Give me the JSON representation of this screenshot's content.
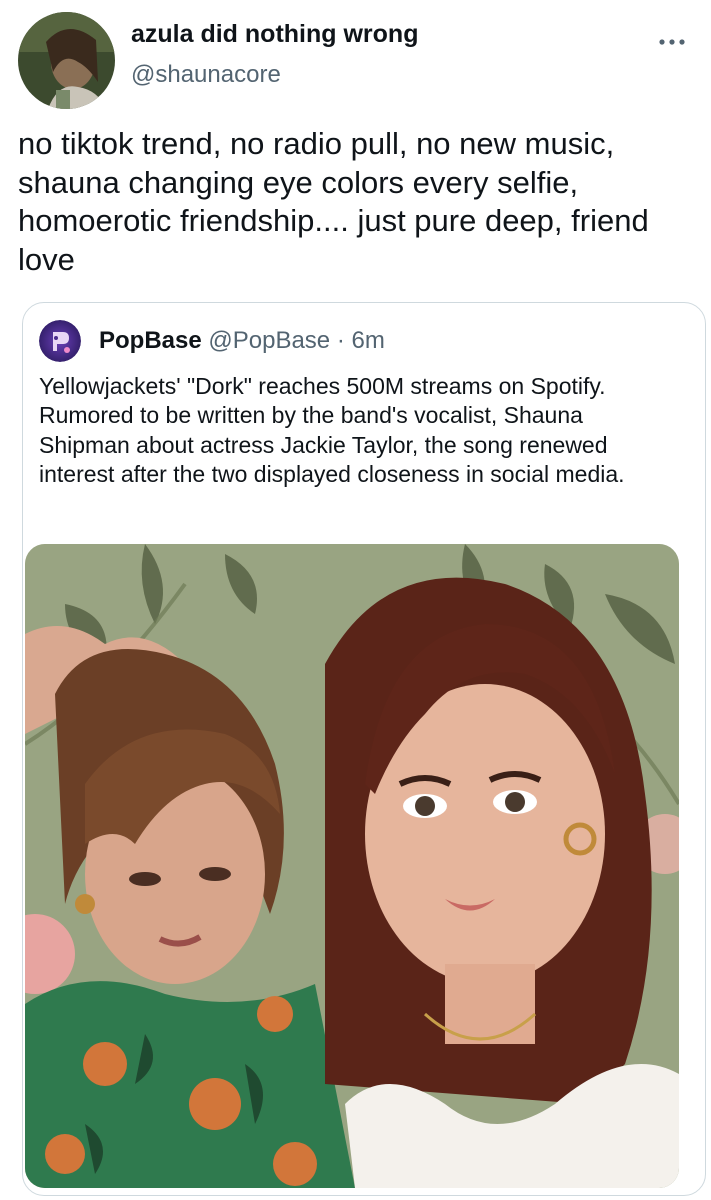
{
  "author": {
    "display_name": "azula did nothing wrong",
    "handle": "@shaunacore",
    "avatar_icon": "user-avatar"
  },
  "tweet": {
    "text": "no tiktok trend, no radio pull, no new music, shauna changing eye colors every selfie, homoerotic friendship.... just pure deep, friend love"
  },
  "quoted_tweet": {
    "display_name": "PopBase",
    "handle": "@PopBase",
    "separator": "·",
    "time": "6m",
    "avatar_icon": "popbase-logo",
    "text": "Yellowjackets' \"Dork\" reaches 500M streams on Spotify. Rumored to be written by the band's vocalist, Shauna Shipman about actress Jackie Taylor, the song renewed interest after the two displayed closeness in social media."
  },
  "icons": {
    "more": "more-horizontal-icon"
  },
  "colors": {
    "text_primary": "#0f1419",
    "text_secondary": "#536471",
    "border": "#cfd9de",
    "popbase_brand": "#4a2a8c"
  }
}
